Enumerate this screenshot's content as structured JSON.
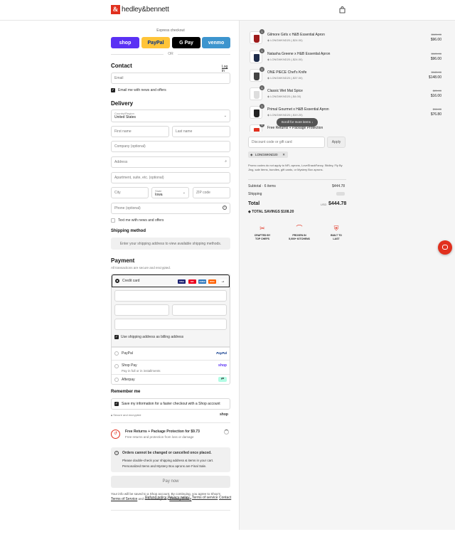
{
  "header": {
    "logo_letter": "&",
    "brand": "hedley&bennett",
    "icons": [
      "bag-icon"
    ]
  },
  "express": {
    "title": "Express checkout",
    "buttons": [
      {
        "label": "shop",
        "color": "#5a31f4"
      },
      {
        "label": "PayPal",
        "color": "#ffc439"
      },
      {
        "label": "G Pay",
        "color": "#000000"
      },
      {
        "label": "venmo",
        "color": "#3d95ce"
      }
    ],
    "or": "OR"
  },
  "contact": {
    "heading": "Contact",
    "login_link": "Log in",
    "email_placeholder": "Email",
    "email_news_label": "Email me with news and offers"
  },
  "delivery": {
    "heading": "Delivery",
    "country_label": "Country/Region",
    "country_value": "United States",
    "first_name": "First name",
    "last_name": "Last name",
    "company": "Company (optional)",
    "address": "Address",
    "apartment": "Apartment, suite, etc. (optional)",
    "city": "City",
    "state_label": "State",
    "state_value": "Iowa",
    "zip": "ZIP code",
    "phone": "Phone (optional)",
    "text_news_label": "Text me with news and offers"
  },
  "shipping": {
    "heading": "Shipping method",
    "message": "Enter your shipping address to view available shipping methods."
  },
  "payment": {
    "heading": "Payment",
    "subtitle": "All transactions are secure and encrypted.",
    "credit_card_label": "Credit card",
    "card_icons": [
      {
        "label": "VISA",
        "color": "#1a1f71"
      },
      {
        "label": "MC",
        "color": "#eb001b"
      },
      {
        "label": "AMEX",
        "color": "#2e77bc"
      },
      {
        "label": "DISC",
        "color": "#ff6000"
      },
      {
        "label": "+4",
        "color": "#ffffff"
      }
    ],
    "billing_label": "Use shipping address as billing address",
    "paypal_label": "PayPal",
    "paypal_logo": "PayPal",
    "shoppay_label": "Shop Pay",
    "shoppay_sub": "Pay in full or in installments",
    "shoppay_logo": "shop",
    "afterpay_label": "Afterpay"
  },
  "remember": {
    "heading": "Remember me",
    "save_label": "Save my information for a faster checkout with a Shop account",
    "secure_label": "Secure and encrypted",
    "shop_logo": "shop"
  },
  "protection": {
    "title": "Free Returns + Package Protection for $9.73",
    "subtitle": "Free returns and protection from loss or damage"
  },
  "notice": {
    "title": "Orders cannot be changed or cancelled once placed.",
    "line1": "Please double-check your shipping address & items in your cart.",
    "line2": "Personalized Items and Mystery Box aprons are Final Sale."
  },
  "pay_now": "Pay now",
  "legal": {
    "line1": "Your info will be saved to a Shop account. By continuing, you agree to Shop's",
    "terms": "Terms of Service",
    "and": "and acknowledge the",
    "privacy": "Privacy Policy",
    "end": "."
  },
  "footer_links": [
    "Refund policy",
    "Privacy policy",
    "Terms of service",
    "Contact"
  ],
  "cart": {
    "items": [
      {
        "qty": "1",
        "name": "Gilmore Girls x H&B Essential Apron",
        "code": "LONGWKND20 (-$24.00)",
        "strike": "$120.00",
        "price": "$96.00",
        "color": "#9e1c1c"
      },
      {
        "qty": "1",
        "name": "Natasha Greene x H&B Essential Apron",
        "code": "LONGWKND20 (-$24.00)",
        "strike": "$120.00",
        "price": "$96.00",
        "color": "#1e2c4a"
      },
      {
        "qty": "1",
        "name": "ONE PIECE Chef's Knife",
        "code": "LONGWKND20 (-$37.00)",
        "strike": "$185.00",
        "price": "$148.00",
        "color": "#444444"
      },
      {
        "qty": "1",
        "name": "Classic Wet Mat Spice",
        "code": "LONGWKND20 (-$4.00)",
        "strike": "$20.00",
        "price": "$16.00",
        "color": "#dddddd"
      },
      {
        "qty": "1",
        "name": "Primal Gourmet x H&B Essential Apron",
        "code": "LONGWKND20 (-$19.20)",
        "strike": "$96.00",
        "price": "$76.80",
        "color": "#222222"
      },
      {
        "qty": "1",
        "name": "Free Returns + Package Protection",
        "code": "",
        "strike": "",
        "price": "$11.98",
        "color": "#e1301e"
      }
    ],
    "scroll_hint": "Scroll for more items",
    "discount_placeholder": "Discount code or gift card",
    "apply": "Apply",
    "discount_tag": "LONGWKND20",
    "promo_note": "Promo codes do not apply to NFL aprons, LoveShackFancy, Stidley, Fly By Jing, sale items, bundles, gift cards, or Mystery Box aprons.",
    "subtotal_label": "Subtotal · 6 items",
    "subtotal": "$444.78",
    "shipping_label": "Shipping",
    "total_label": "Total",
    "currency": "USD",
    "total": "$444.78",
    "savings_label": "TOTAL SAVINGS",
    "savings": "$108.20",
    "badges": [
      {
        "label": "CRAFTED BY\nTOP CHEFS",
        "icon": "knives-icon"
      },
      {
        "label": "PROVEN IN\n5,000+ KITCHENS",
        "icon": "chef-hat-icon"
      },
      {
        "label": "BUILT TO\nLAST",
        "icon": "shield-icon"
      }
    ]
  },
  "colors": {
    "brand": "#e1301e",
    "accent": "#1a1a1a"
  }
}
